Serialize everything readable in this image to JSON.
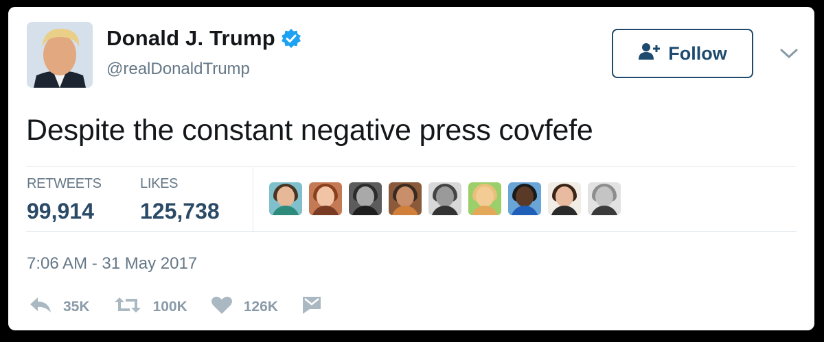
{
  "tweet": {
    "author_name": "Donald J. Trump",
    "author_handle": "@realDonaldTrump",
    "follow_label": "Follow",
    "text": "Despite the constant negative press covfefe",
    "timestamp": "7:06 AM - 31 May 2017"
  },
  "stats": {
    "retweets_label": "RETWEETS",
    "retweets_value": "99,914",
    "likes_label": "LIKES",
    "likes_value": "125,738"
  },
  "likers_count": 9,
  "actions": {
    "reply_count": "35K",
    "retweet_count": "100K",
    "like_count": "126K"
  },
  "icons": {
    "verified": "verified-badge-icon",
    "follow": "add-user-icon",
    "caret": "chevron-down-icon",
    "reply": "reply-icon",
    "retweet": "retweet-icon",
    "like": "heart-icon",
    "dm": "direct-message-icon"
  },
  "colors": {
    "accent": "#1d4a6e",
    "verified": "#1da1f2",
    "muted": "#657786",
    "action_icon": "#aab8c2"
  }
}
